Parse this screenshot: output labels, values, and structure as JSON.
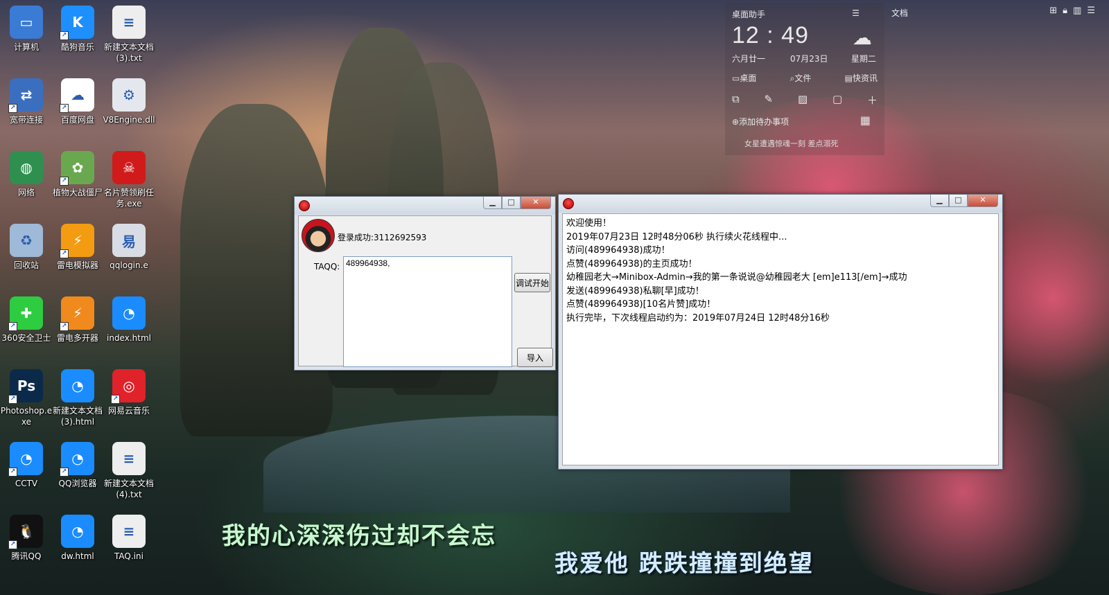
{
  "desktop_icons": [
    {
      "label": "计算机",
      "icon": "computer-icon",
      "color": "#3a7bd5",
      "glyph": "▭",
      "shortcut": false
    },
    {
      "label": "酷狗音乐",
      "icon": "kugou-music-icon",
      "color": "#1e8fff",
      "glyph": "K",
      "shortcut": true
    },
    {
      "label": "新建文本文档(3).txt",
      "icon": "text-file-icon",
      "color": "#eeeeee",
      "glyph": "≡",
      "shortcut": false
    },
    {
      "label": "宽带连接",
      "icon": "broadband-connection-icon",
      "color": "#3a6fc0",
      "glyph": "⇄",
      "shortcut": true
    },
    {
      "label": "百度网盘",
      "icon": "baidu-netdisk-icon",
      "color": "#ffffff",
      "glyph": "☁",
      "shortcut": true
    },
    {
      "label": "V8Engine.dll",
      "icon": "dll-file-icon",
      "color": "#e4e8ee",
      "glyph": "⚙",
      "shortcut": false
    },
    {
      "label": "网络",
      "icon": "network-icon",
      "color": "#2f8f4f",
      "glyph": "◍",
      "shortcut": false
    },
    {
      "label": "植物大战僵尸",
      "icon": "plants-vs-zombies-icon",
      "color": "#6aa84f",
      "glyph": "✿",
      "shortcut": true
    },
    {
      "label": "名片赞领刷任务.exe",
      "icon": "skull-app-icon",
      "color": "#d11b1b",
      "glyph": "☠",
      "shortcut": false
    },
    {
      "label": "回收站",
      "icon": "recycle-bin-icon",
      "color": "#9fb9d8",
      "glyph": "♻",
      "shortcut": false
    },
    {
      "label": "雷电模拟器",
      "icon": "leidian-emulator-icon",
      "color": "#f39c12",
      "glyph": "⚡",
      "shortcut": true
    },
    {
      "label": "qqlogin.e",
      "icon": "qqlogin-icon",
      "color": "#d8dde5",
      "glyph": "易",
      "shortcut": false
    },
    {
      "label": "360安全卫士",
      "icon": "360-security-icon",
      "color": "#2ecc40",
      "glyph": "✚",
      "shortcut": true
    },
    {
      "label": "雷电多开器",
      "icon": "leidian-multi-icon",
      "color": "#f08a1c",
      "glyph": "⚡",
      "shortcut": true
    },
    {
      "label": "index.html",
      "icon": "qq-browser-file-icon",
      "color": "#1a8cff",
      "glyph": "◔",
      "shortcut": false
    },
    {
      "label": "Photoshop.exe",
      "icon": "photoshop-icon",
      "color": "#0b2a4a",
      "glyph": "Ps",
      "shortcut": true
    },
    {
      "label": "新建文本文档(3).html",
      "icon": "qq-browser-file-icon",
      "color": "#1a8cff",
      "glyph": "◔",
      "shortcut": false
    },
    {
      "label": "网易云音乐",
      "icon": "netease-music-icon",
      "color": "#e0222b",
      "glyph": "◎",
      "shortcut": true
    },
    {
      "label": "CCTV",
      "icon": "qq-browser-shortcut-icon",
      "color": "#1a8cff",
      "glyph": "◔",
      "shortcut": true
    },
    {
      "label": "QQ浏览器",
      "icon": "qq-browser-icon",
      "color": "#1a8cff",
      "glyph": "◔",
      "shortcut": true
    },
    {
      "label": "新建文本文档(4).txt",
      "icon": "text-file-icon",
      "color": "#eeeeee",
      "glyph": "≡",
      "shortcut": false
    },
    {
      "label": "腾讯QQ",
      "icon": "tencent-qq-icon",
      "color": "#111111",
      "glyph": "🐧",
      "shortcut": true
    },
    {
      "label": "dw.html",
      "icon": "qq-browser-file-icon",
      "color": "#1a8cff",
      "glyph": "◔",
      "shortcut": false
    },
    {
      "label": "TAQ.ini",
      "icon": "ini-file-icon",
      "color": "#eeeeee",
      "glyph": "≡",
      "shortcut": false
    }
  ],
  "widget": {
    "title": "桌面助手",
    "time": "12 : 49",
    "lunar": "六月廿一",
    "date": "07月23日",
    "weekday": "星期二",
    "tabs": [
      "桌面",
      "文件",
      "快资讯"
    ],
    "todo": "添加待办事项",
    "news": "女星遭遇惊魂一刻 差点溺死"
  },
  "doc_label": "文档",
  "login_window": {
    "status": "登录成功:3112692593",
    "taqq_label": "TAQQ:",
    "taqq_value": "489964938,",
    "start_button": "调试开始",
    "import_button": "导入"
  },
  "log_window": {
    "lines": [
      "欢迎使用！",
      "2019年07月23日 12时48分06秒 执行续火花线程中...",
      "访问(489964938)成功！",
      "点赞(489964938)的主页成功！",
      "幼稚园老大→Minibox-Admin→我的第一条说说@幼稚园老大 [em]e113[/em]→成功",
      "发送(489964938)私聊[早]成功！",
      "点赞(489964938)[10名片赞]成功！",
      "执行完毕，下次线程启动约为：2019年07月24日 12时48分16秒"
    ]
  },
  "lyrics": {
    "line1": "我的心深深伤过却不会忘",
    "line2": "我爱他 跌跌撞撞到绝望"
  }
}
